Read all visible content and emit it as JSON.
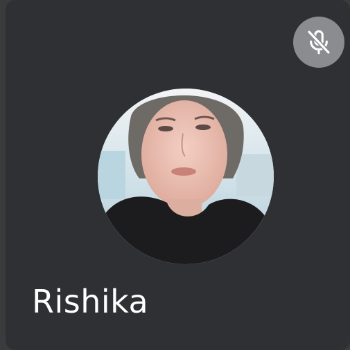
{
  "participant": {
    "name": "Rishika",
    "avatar_icon": "participant-photo",
    "mic_status_icon": "mic-off-icon",
    "muted": true
  },
  "colors": {
    "tile_background": "#2f3033",
    "mute_badge": "#8a8c90",
    "name_text": "#ffffff"
  }
}
